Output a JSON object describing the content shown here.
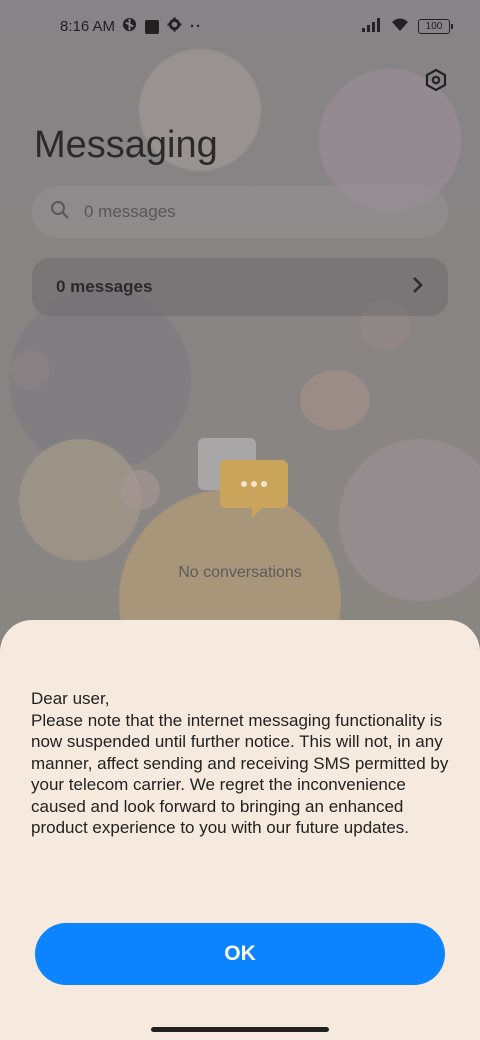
{
  "status_bar": {
    "time": "8:16 AM",
    "battery": "100"
  },
  "header": {
    "title": "Messaging"
  },
  "search": {
    "placeholder": "0 messages"
  },
  "summary_row": {
    "label": "0 messages"
  },
  "empty_state": {
    "text": "No conversations"
  },
  "dialog": {
    "lines": [
      "Dear user,",
      "Please note that the internet messaging functionality is now suspended until further notice. This will not, in any manner, affect sending and receiving SMS permitted by your telecom carrier. We regret the inconvenience caused and look forward to bringing an enhanced product experience to you with our future updates."
    ],
    "ok_label": "OK"
  },
  "colors": {
    "accent": "#0d84ff",
    "sheet_bg": "#f6eadf"
  }
}
